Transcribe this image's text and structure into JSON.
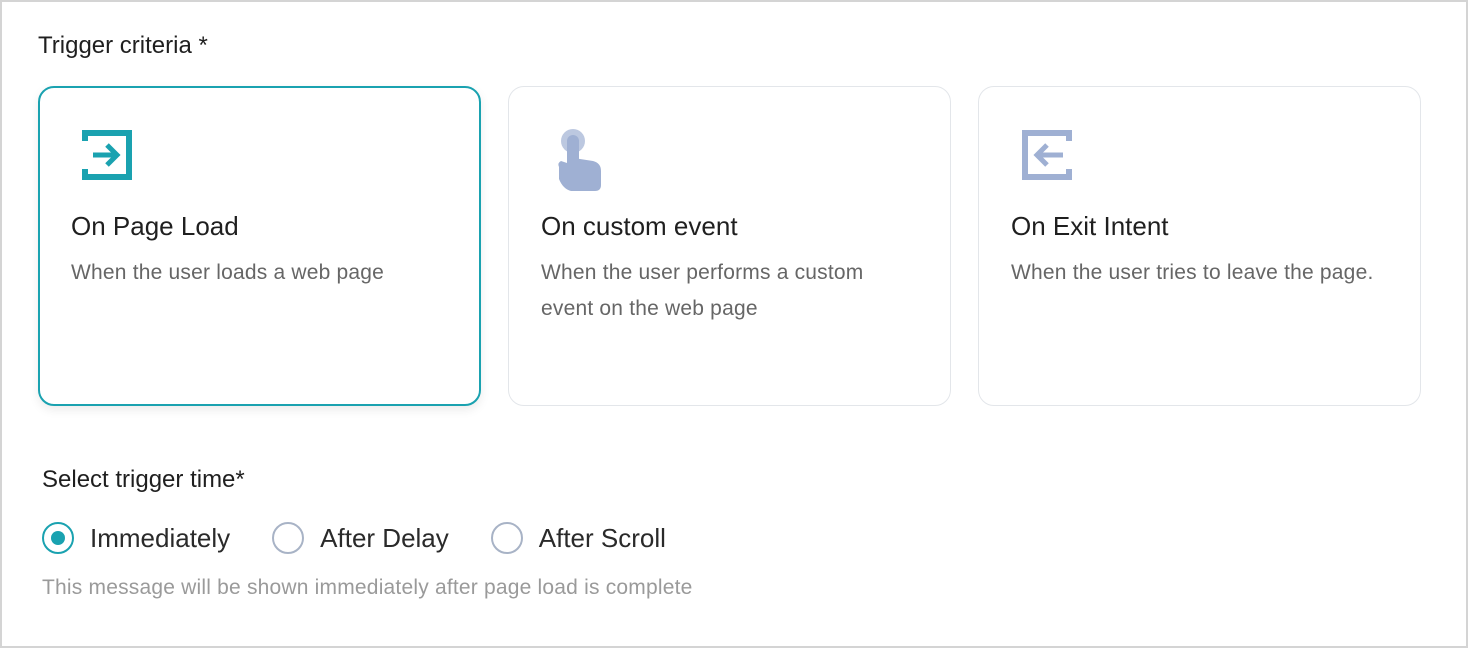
{
  "trigger_criteria": {
    "title": "Trigger criteria *",
    "cards": [
      {
        "title": "On Page Load",
        "description": "When the user loads a web page",
        "icon": "enter-icon",
        "selected": true
      },
      {
        "title": "On custom event",
        "description": "When the user performs a custom event on the web page",
        "icon": "tap-hand-icon",
        "selected": false
      },
      {
        "title": "On Exit Intent",
        "description": "When the user tries to leave the page.",
        "icon": "exit-icon",
        "selected": false
      }
    ]
  },
  "trigger_time": {
    "title": "Select trigger time*",
    "options": [
      {
        "label": "Immediately",
        "checked": true
      },
      {
        "label": "After Delay",
        "checked": false
      },
      {
        "label": "After Scroll",
        "checked": false
      }
    ],
    "helper_text": "This message will be shown immediately after page load is complete"
  },
  "colors": {
    "accent": "#1aa2b0",
    "icon_muted": "#9fb0d3",
    "border": "#e3e6ea"
  }
}
